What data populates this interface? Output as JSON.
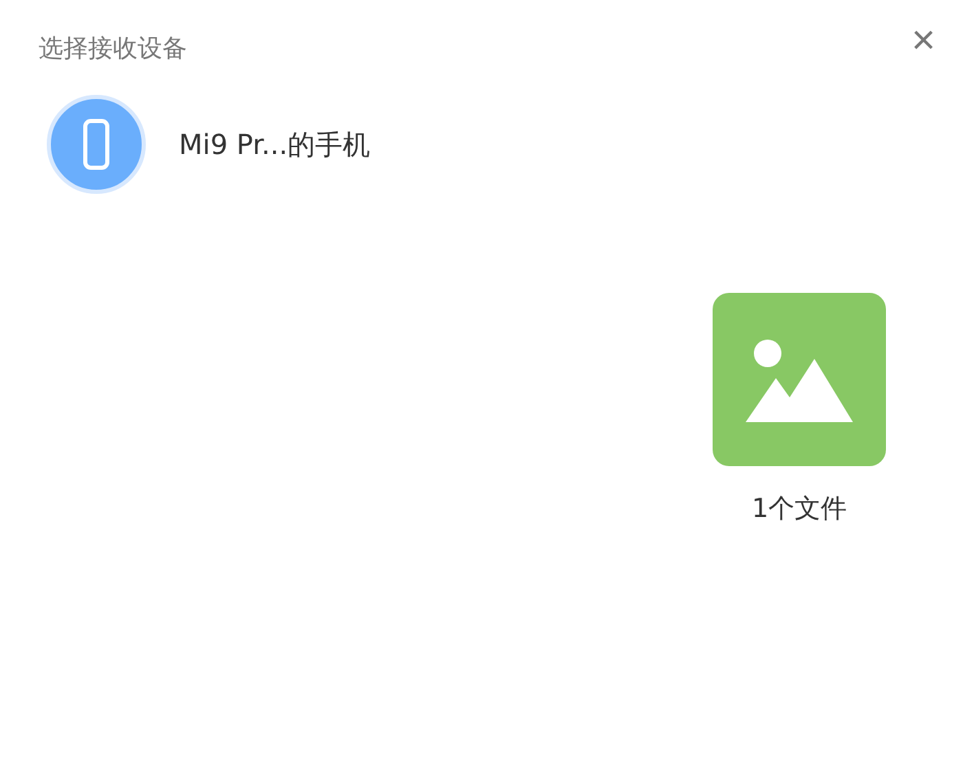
{
  "window": {
    "title": "选择接收设备",
    "close": "×"
  },
  "devices": [
    {
      "name": "Mi9 Pr...的手机"
    }
  ],
  "file": {
    "label": "1个文件"
  }
}
